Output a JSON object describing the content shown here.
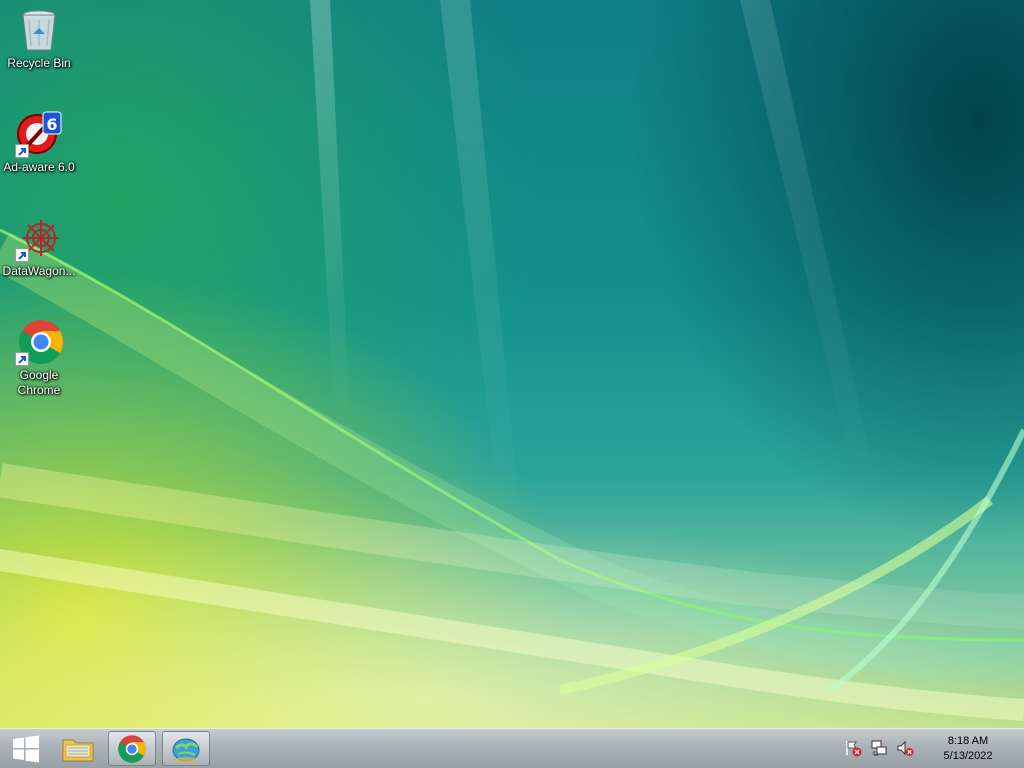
{
  "desktop": {
    "icons": [
      {
        "label": "Recycle Bin"
      },
      {
        "label": "Ad-aware 6.0"
      },
      {
        "label": "DataWagon..."
      },
      {
        "label": "Google Chrome"
      }
    ]
  },
  "taskbar": {
    "pinned": [
      "windows-explorer",
      "google-chrome",
      "network-globe"
    ],
    "tray": {
      "icons": [
        "action-center-flag-icon",
        "network-icon",
        "volume-muted-icon"
      ]
    },
    "clock": {
      "time": "8:18 AM",
      "date": "5/13/2022"
    }
  },
  "colors": {
    "taskbar_bg": "#a9b2b6",
    "wallpaper_teal": "#13908e",
    "wallpaper_yellow": "#e6eb28"
  }
}
